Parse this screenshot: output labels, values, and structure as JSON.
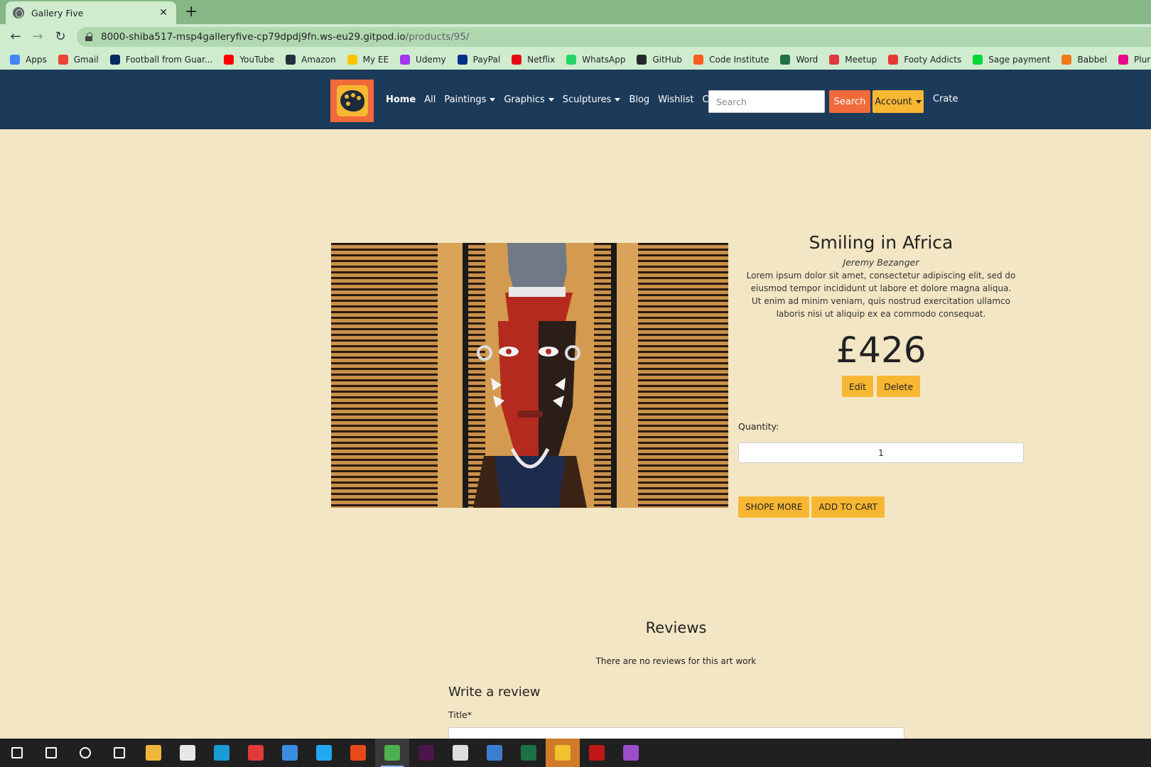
{
  "browser": {
    "tab_title": "Gallery Five",
    "tab_close": "✕",
    "new_tab": "+",
    "url_host": "8000-shiba517-msp4galleryfive-cp79dpdj9fn.ws-eu29.gitpod.io",
    "url_path": "/products/95/",
    "bookmarks": [
      {
        "label": "Apps",
        "color": "#4285f4"
      },
      {
        "label": "Gmail",
        "color": "#ea4335"
      },
      {
        "label": "Football from Guar...",
        "color": "#052962"
      },
      {
        "label": "YouTube",
        "color": "#ff0000"
      },
      {
        "label": "Amazon",
        "color": "#232f3e"
      },
      {
        "label": "My EE",
        "color": "#ffc400"
      },
      {
        "label": "Udemy",
        "color": "#a435f0"
      },
      {
        "label": "PayPal",
        "color": "#003087"
      },
      {
        "label": "Netflix",
        "color": "#e50914"
      },
      {
        "label": "WhatsApp",
        "color": "#25d366"
      },
      {
        "label": "GitHub",
        "color": "#24292e"
      },
      {
        "label": "Code Institute",
        "color": "#ff5a1f"
      },
      {
        "label": "Word",
        "color": "#1e7145"
      },
      {
        "label": "Meetup",
        "color": "#e0393e"
      },
      {
        "label": "Footy Addicts",
        "color": "#e53935"
      },
      {
        "label": "Sage payment",
        "color": "#00d639"
      },
      {
        "label": "Babbel",
        "color": "#f07a1a"
      },
      {
        "label": "Pluralsight",
        "color": "#e80a89"
      }
    ]
  },
  "nav": {
    "links": [
      {
        "label": "Home",
        "active": true,
        "dropdown": false
      },
      {
        "label": "All",
        "active": false,
        "dropdown": false
      },
      {
        "label": "Paintings",
        "active": false,
        "dropdown": true
      },
      {
        "label": "Graphics",
        "active": false,
        "dropdown": true
      },
      {
        "label": "Sculptures",
        "active": false,
        "dropdown": true
      },
      {
        "label": "Blog",
        "active": false,
        "dropdown": false
      },
      {
        "label": "Wishlist",
        "active": false,
        "dropdown": false
      },
      {
        "label": "Contact",
        "active": false,
        "dropdown": false
      }
    ],
    "search_placeholder": "Search",
    "search_button": "Search",
    "account_button": "Account",
    "crate_link": "Crate"
  },
  "product": {
    "title": "Smiling in Africa",
    "artist": "Jeremy Bezanger",
    "description": "Lorem ipsum dolor sit amet, consectetur adipiscing elit, sed do eiusmod tempor incididunt ut labore et dolore magna aliqua. Ut enim ad minim veniam, quis nostrud exercitation ullamco laboris nisi ut aliquip ex ea commodo consequat.",
    "price": "£426",
    "edit_button": "Edit",
    "delete_button": "Delete",
    "quantity_label": "Quantity:",
    "quantity_value": "1",
    "shop_more_button": "SHOPE MORE",
    "add_to_cart_button": "ADD TO CART"
  },
  "reviews": {
    "heading": "Reviews",
    "empty_message": "There are no reviews for this art work",
    "write_heading": "Write a review",
    "title_label": "Title*"
  },
  "taskbar": {
    "items": [
      {
        "icon": "windows-start-icon",
        "color": "#ffffff"
      },
      {
        "icon": "search-icon",
        "color": "#ffffff"
      },
      {
        "icon": "cortana-icon",
        "color": "#ffffff"
      },
      {
        "icon": "task-view-icon",
        "color": "#ffffff"
      },
      {
        "icon": "file-explorer-icon",
        "color": "#f2b53b"
      },
      {
        "icon": "store-icon",
        "color": "#e8e8e8"
      },
      {
        "icon": "edge-icon",
        "color": "#1a9bd7"
      },
      {
        "icon": "gift-icon",
        "color": "#e03a3a"
      },
      {
        "icon": "mail-icon",
        "color": "#3b8de0"
      },
      {
        "icon": "vscode-icon",
        "color": "#23a9f2"
      },
      {
        "icon": "office-icon",
        "color": "#e64a19"
      },
      {
        "icon": "chrome-icon",
        "color": "#4caf50"
      },
      {
        "icon": "slack-icon",
        "color": "#4a154b"
      },
      {
        "icon": "emoji-icon",
        "color": "#dddddd"
      },
      {
        "icon": "photos-icon",
        "color": "#3c7fd1"
      },
      {
        "icon": "excel-icon",
        "color": "#1e7145"
      },
      {
        "icon": "security-shield-icon",
        "color": "#f2c12e"
      },
      {
        "icon": "mcafee-icon",
        "color": "#c01818"
      },
      {
        "icon": "paint-drop-icon",
        "color": "#9c4dcc"
      }
    ]
  }
}
